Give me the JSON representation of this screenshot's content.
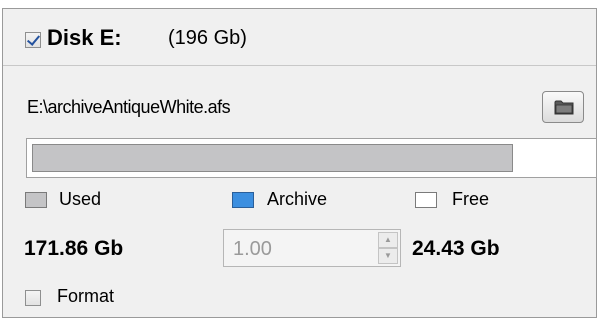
{
  "disk": {
    "checked": true,
    "title": "Disk E:",
    "size": "(196 Gb)",
    "path": "E:\\archiveAntiqueWhite.afs",
    "used_fraction": 0.86
  },
  "legend": {
    "used_label": "Used",
    "archive_label": "Archive",
    "free_label": "Free"
  },
  "values": {
    "used": "171.86 Gb",
    "archive": "1.00",
    "free": "24.43 Gb"
  },
  "format": {
    "label": "Format",
    "checked": false
  },
  "icons": {
    "folder": "folder-icon",
    "spin_up": "chevron-up-icon",
    "spin_down": "chevron-down-icon"
  },
  "colors": {
    "used": "#c4c4c6",
    "archive": "#3c8fe0",
    "free": "#ffffff",
    "checkmark": "#24529e"
  }
}
